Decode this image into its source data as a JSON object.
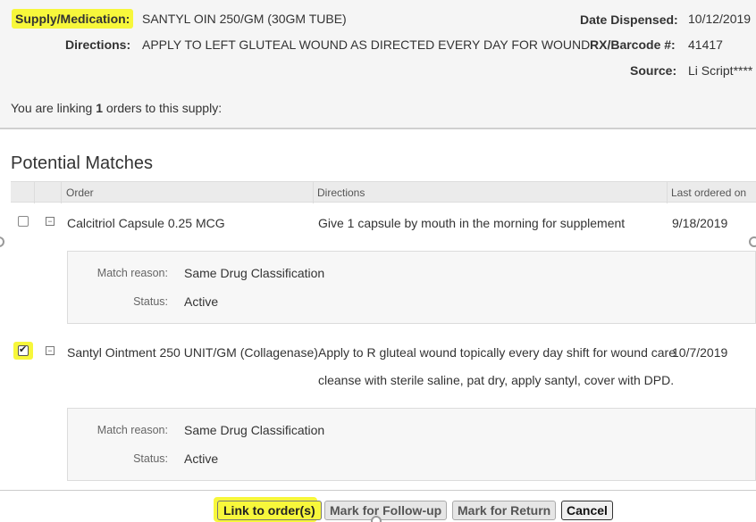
{
  "header": {
    "supply_label": "Supply/Medication:",
    "supply_value": "SANTYL OIN 250/GM (30GM TUBE)",
    "directions_label": "Directions:",
    "directions_value": "APPLY TO LEFT GLUTEAL WOUND AS DIRECTED EVERY DAY FOR WOUND",
    "date_label": "Date Dispensed:",
    "date_value": "10/12/2019",
    "rx_label": "RX/Barcode #:",
    "rx_value": "41417",
    "source_label": "Source:",
    "source_value": "Li Script****"
  },
  "linking": {
    "prefix": "You are linking",
    "count": "1",
    "suffix": "orders to this supply:"
  },
  "matches": {
    "title": "Potential Matches",
    "columns": [
      "Order",
      "Directions",
      "Last ordered on"
    ],
    "rows": [
      {
        "checked": false,
        "order": "Calcitriol Capsule 0.25 MCG",
        "directions_line1": "Give 1 capsule by mouth in the morning for supplement",
        "directions_line2": "",
        "last_ordered": "9/18/2019",
        "match_reason_label": "Match reason:",
        "match_reason": "Same Drug Classification",
        "status_label": "Status:",
        "status": "Active"
      },
      {
        "checked": true,
        "order": "Santyl Ointment 250 UNIT/GM (Collagenase)",
        "directions_line1": "Apply to R gluteal wound topically every day shift for wound care",
        "directions_line2": "cleanse with sterile saline, pat dry, apply santyl, cover with DPD.",
        "last_ordered": "10/7/2019",
        "match_reason_label": "Match reason:",
        "match_reason": "Same Drug Classification",
        "status_label": "Status:",
        "status": "Active"
      }
    ]
  },
  "buttons": {
    "link": "Link to order(s)",
    "followup": "Mark for Follow-up",
    "return": "Mark for Return",
    "cancel": "Cancel"
  },
  "colors": {
    "highlight": "#f7f73b",
    "header_bg": "#f5f5f5",
    "table_header_bg": "#ebebeb"
  }
}
